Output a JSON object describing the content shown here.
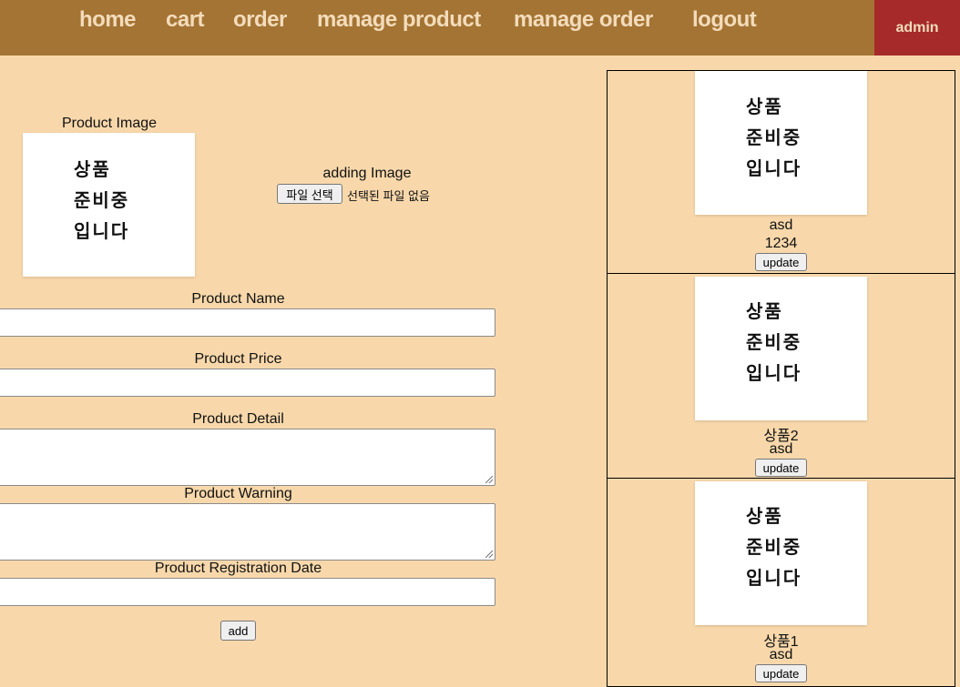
{
  "nav": {
    "items": [
      "home",
      "cart",
      "order",
      "manage product",
      "manage order",
      "logout"
    ],
    "admin": "admin"
  },
  "form": {
    "image_label": "Product Image",
    "placeholder_lines": [
      "상품",
      "준비중",
      "입니다"
    ],
    "adding_label": "adding Image",
    "file_button": "파일 선택",
    "file_status": "선택된 파일 없음",
    "name_label": "Product Name",
    "price_label": "Product Price",
    "detail_label": "Product Detail",
    "warning_label": "Product Warning",
    "date_label": "Product Registration Date",
    "add_button": "add"
  },
  "products": [
    {
      "line1": "asd",
      "line2": "1234",
      "button": "update"
    },
    {
      "line1": "상품2",
      "line2": "asd",
      "button": "update"
    },
    {
      "line1": "상품1",
      "line2": "asd",
      "button": "update"
    }
  ],
  "colors": {
    "nav_bg": "#a47434",
    "admin_bg": "#a62a2a",
    "page_bg": "#f8d8ab",
    "nav_text": "#f3dcbb"
  }
}
